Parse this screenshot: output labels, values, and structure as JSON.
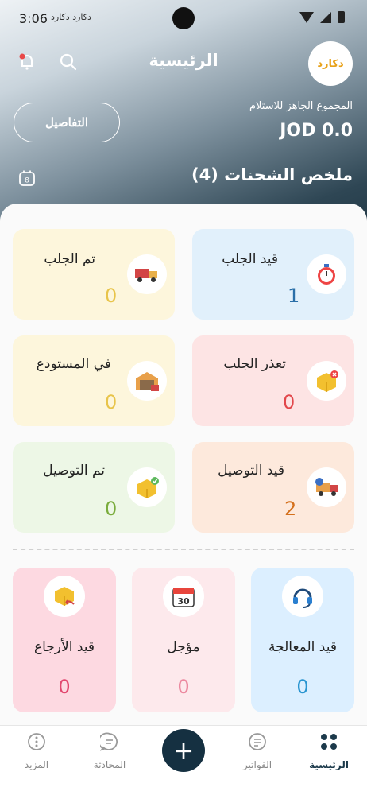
{
  "status": {
    "time": "3:06",
    "notifications": "دكارد  دكارد"
  },
  "header": {
    "title": "الرئيسية",
    "logo_text": "دكارد"
  },
  "balance": {
    "label": "المجموع الجاهز للاستلام",
    "amount": "JOD 0.0",
    "details_button": "التفاصيل"
  },
  "summary": {
    "title": "ملخص الشحنات (4)",
    "calendar_badge": "8"
  },
  "cards": [
    {
      "label": "قيد الجلب",
      "count": "1",
      "icon": "stopwatch-icon",
      "bg": "#e1f0fb",
      "color": "#2a6fa8"
    },
    {
      "label": "تم الجلب",
      "count": "0",
      "icon": "truck-icon",
      "bg": "#fdf6dc",
      "color": "#e8c44a"
    },
    {
      "label": "تعذر الجلب",
      "count": "0",
      "icon": "box-error-icon",
      "bg": "#fde4e4",
      "color": "#e2474b"
    },
    {
      "label": "في المستودع",
      "count": "0",
      "icon": "warehouse-icon",
      "bg": "#fdf6dc",
      "color": "#e8c44a"
    },
    {
      "label": "قيد التوصيل",
      "count": "2",
      "icon": "delivery-truck-icon",
      "bg": "#fde9dc",
      "color": "#d4701c"
    },
    {
      "label": "تم التوصيل",
      "count": "0",
      "icon": "box-check-icon",
      "bg": "#edf7e6",
      "color": "#7aac3c"
    }
  ],
  "bottom_cards": [
    {
      "label": "قيد المعالجة",
      "count": "0",
      "icon": "headset-icon",
      "bg": "#dcefff",
      "color": "#2a95d0"
    },
    {
      "label": "مؤجل",
      "count": "0",
      "icon": "calendar-30-icon",
      "bg": "#fde9ec",
      "color": "#ec8aa0"
    },
    {
      "label": "قيد الأرجاع",
      "count": "0",
      "icon": "box-return-icon",
      "bg": "#fdd9e1",
      "color": "#e2476e"
    }
  ],
  "nav": {
    "home": "الرئيسية",
    "invoices": "الفواتير",
    "add": "+",
    "chat": "المحادثة",
    "more": "المزيد"
  }
}
